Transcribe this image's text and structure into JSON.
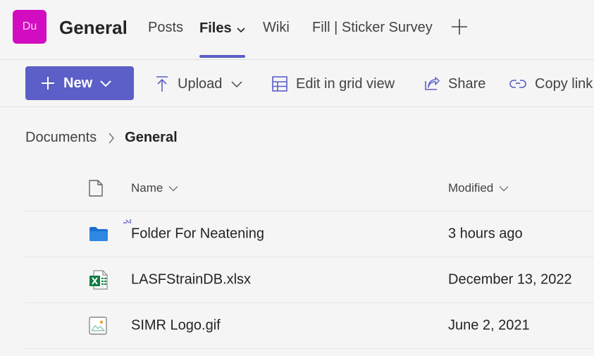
{
  "header": {
    "avatar_initials": "Du",
    "avatar_color": "#d20dc1",
    "channel_title": "General",
    "tabs": [
      {
        "label": "Posts",
        "active": false
      },
      {
        "label": "Files",
        "active": true,
        "has_dropdown": true
      },
      {
        "label": "Wiki",
        "active": false
      },
      {
        "label": "Fill | Sticker Survey",
        "active": false
      }
    ],
    "add_tab_icon": "plus-icon"
  },
  "toolbar": {
    "new_label": "New",
    "upload_label": "Upload",
    "edit_grid_label": "Edit in grid view",
    "share_label": "Share",
    "copy_link_label": "Copy link",
    "accent_color": "#5b5fc7"
  },
  "breadcrumb": {
    "items": [
      "Documents"
    ],
    "current": "General"
  },
  "table": {
    "columns": {
      "type_icon": "file-icon",
      "name": "Name",
      "modified": "Modified"
    },
    "rows": [
      {
        "icon": "folder-icon",
        "name": "Folder For Neatening",
        "modified": "3 hours ago",
        "is_new": true
      },
      {
        "icon": "excel-file-icon",
        "name": "LASFStrainDB.xlsx",
        "modified": "December 13, 2022",
        "is_new": false
      },
      {
        "icon": "image-file-icon",
        "name": "SIMR Logo.gif",
        "modified": "June 2, 2021",
        "is_new": false
      }
    ]
  }
}
